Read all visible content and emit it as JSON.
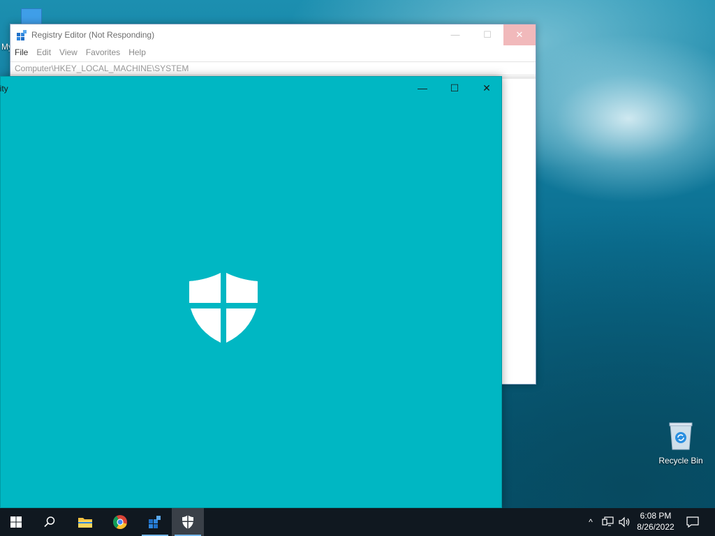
{
  "desktop": {
    "icons": [
      {
        "label": "My"
      },
      {
        "label": "Recycle Bin"
      }
    ]
  },
  "registry_editor": {
    "title": "Registry Editor (Not Responding)",
    "menu": [
      "File",
      "Edit",
      "View",
      "Favorites",
      "Help"
    ],
    "address": "Computer\\HKEY_LOCAL_MACHINE\\SYSTEM",
    "controls": {
      "minimize": "—",
      "maximize": "☐",
      "close": "✕"
    }
  },
  "security_window": {
    "title": "urity",
    "background_color": "#00b7c3",
    "controls": {
      "minimize": "—",
      "maximize": "☐",
      "close": "✕"
    },
    "splash_icon": "shield-icon"
  },
  "taskbar": {
    "buttons": [
      {
        "name": "start",
        "icon": "windows-logo-icon"
      },
      {
        "name": "search",
        "icon": "search-icon"
      },
      {
        "name": "file-explorer",
        "icon": "folder-icon"
      },
      {
        "name": "chrome",
        "icon": "chrome-icon"
      },
      {
        "name": "registry-editor",
        "icon": "regedit-icon",
        "active": true
      },
      {
        "name": "windows-security",
        "icon": "shield-icon",
        "active": true,
        "focused": true
      }
    ],
    "tray": {
      "chevron": "^",
      "time": "6:08 PM",
      "date": "8/26/2022"
    }
  }
}
